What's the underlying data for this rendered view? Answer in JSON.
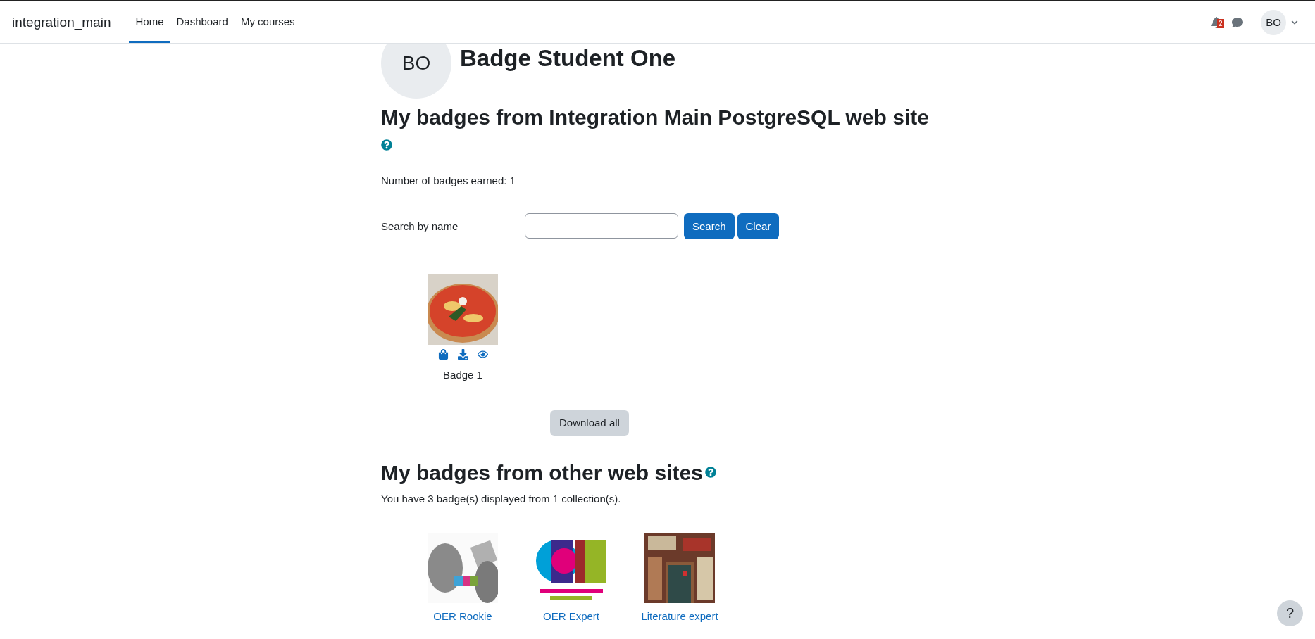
{
  "navbar": {
    "brand": "integration_main",
    "links": [
      {
        "label": "Home",
        "selected": true
      },
      {
        "label": "Dashboard",
        "selected": false
      },
      {
        "label": "My courses",
        "selected": false
      }
    ],
    "notification_count": "2",
    "user_initials": "BO"
  },
  "profile": {
    "initials": "BO",
    "name": "Badge Student One"
  },
  "site_badges": {
    "heading": "My badges from Integration Main PostgreSQL web site",
    "count_text": "Number of badges earned: 1",
    "search": {
      "label": "Search by name",
      "buttons": [
        "Search",
        "Clear"
      ]
    },
    "badges": [
      {
        "name": "Badge 1",
        "kind": "picture"
      }
    ],
    "download_button": "Download all"
  },
  "other_badges": {
    "heading": "My badges from other web sites",
    "summary": "You have 3 badge(s) displayed from 1 collection(s).",
    "badges": [
      {
        "name": "OER Rookie",
        "kind": "picture"
      },
      {
        "name": "OER Expert",
        "kind": "picture"
      },
      {
        "name": "Literature expert",
        "kind": "picture"
      }
    ]
  },
  "help_button": "?"
}
